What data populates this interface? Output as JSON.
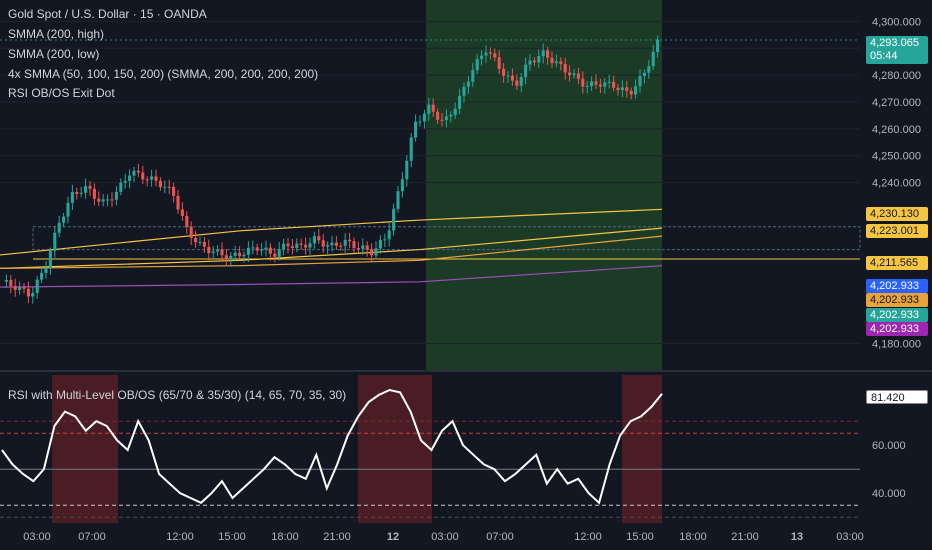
{
  "legend": {
    "symbol": "Gold Spot / U.S. Dollar · 15 · OANDA",
    "ind1": "SMMA (200, high)",
    "ind2": "SMMA (200, low)",
    "ind3": "4x SMMA (50, 100, 150, 200) (SMMA, 200, 200, 200, 200)",
    "ind4": "RSI OB/OS Exit Dot",
    "rsi_title": "RSI with Multi-Level OB/OS (65/70 & 35/30) (14, 65, 70, 35, 30)"
  },
  "colors": {
    "background": "#131722",
    "up": "#26a69a",
    "down": "#ef5350",
    "smma_high": "#f5c542",
    "smma_low": "#f5c542",
    "smma_orange": "#e8a33d",
    "smma_purple": "#9c4fb5",
    "rsi_line": "#ffffff",
    "green_zone": "#1c3b26",
    "red_zone": "#4a1c24"
  },
  "current_price": {
    "price": "4,293.065",
    "countdown": "05:44"
  },
  "price_tags": [
    {
      "label": "4,230.130",
      "bg": "#f5c542",
      "fg": "#131722"
    },
    {
      "label": "4,223.001",
      "bg": "#f5c542",
      "fg": "#131722"
    },
    {
      "label": "4,211.565",
      "bg": "#f5c542",
      "fg": "#131722"
    },
    {
      "label": "4,202.933",
      "bg": "#2962ff",
      "fg": "#ffffff"
    },
    {
      "label": "4,202.933",
      "bg": "#e8a33d",
      "fg": "#131722"
    },
    {
      "label": "4,202.933",
      "bg": "#26a69a",
      "fg": "#ffffff"
    },
    {
      "label": "4,202.933",
      "bg": "#9c27b0",
      "fg": "#ffffff"
    }
  ],
  "rsi_tag": {
    "label": "81.420"
  },
  "chart_data": [
    {
      "type": "candlestick",
      "title": "Gold Spot / U.S. Dollar · 15 · OANDA",
      "ylim": [
        4172,
        4305
      ],
      "y_ticks": [
        "4,300.000",
        "4,290.000",
        "4,280.000",
        "4,270.000",
        "4,260.000",
        "4,250.000",
        "4,240.000",
        "4,180.000"
      ],
      "y_tick_values": [
        4300,
        4290,
        4280,
        4270,
        4260,
        4250,
        4240,
        4180
      ],
      "x_ticks": [
        "03:00",
        "07:00",
        "12:00",
        "15:00",
        "18:00",
        "21:00",
        "12",
        "03:00",
        "07:00",
        "12:00",
        "15:00",
        "18:00",
        "21:00",
        "13",
        "03:00"
      ],
      "close_path": [
        4203,
        4201,
        4198,
        4208,
        4225,
        4236,
        4238,
        4232,
        4236,
        4244,
        4242,
        4240,
        4236,
        4222,
        4216,
        4214,
        4212,
        4214,
        4216,
        4213,
        4217,
        4216,
        4219,
        4216,
        4218,
        4216,
        4214,
        4220,
        4240,
        4262,
        4268,
        4262,
        4270,
        4282,
        4290,
        4282,
        4276,
        4285,
        4288,
        4284,
        4280,
        4276,
        4277,
        4276,
        4273,
        4280,
        4292
      ],
      "series": [
        {
          "name": "SMMA (200, high)",
          "values": [
            4213,
            4222,
            4226,
            4230
          ]
        },
        {
          "name": "SMMA (200, low)",
          "values": [
            4208,
            4211,
            4215,
            4223
          ]
        },
        {
          "name": "SMMA orange",
          "values": [
            4208,
            4209,
            4211,
            4220
          ]
        },
        {
          "name": "SMMA purple",
          "values": [
            4201,
            4202,
            4203,
            4209
          ]
        }
      ]
    },
    {
      "type": "line",
      "title": "RSI with Multi-Level OB/OS (65/70 & 35/30) (14, 65, 70, 35, 30)",
      "ylim": [
        28,
        88
      ],
      "y_ticks": [
        "60.000",
        "40.000"
      ],
      "y_tick_values": [
        60,
        40
      ],
      "levels": [
        70,
        65,
        50,
        35,
        30
      ],
      "values": [
        58,
        52,
        48,
        45,
        50,
        68,
        74,
        72,
        66,
        70,
        68,
        62,
        58,
        70,
        62,
        48,
        44,
        40,
        38,
        36,
        40,
        45,
        38,
        42,
        46,
        50,
        55,
        52,
        48,
        46,
        56,
        42,
        52,
        64,
        72,
        78,
        81,
        83,
        82,
        74,
        62,
        58,
        66,
        70,
        60,
        56,
        52,
        50,
        45,
        48,
        52,
        56,
        44,
        50,
        44,
        46,
        40,
        36,
        52,
        64,
        70,
        72,
        76,
        81.42
      ]
    }
  ]
}
